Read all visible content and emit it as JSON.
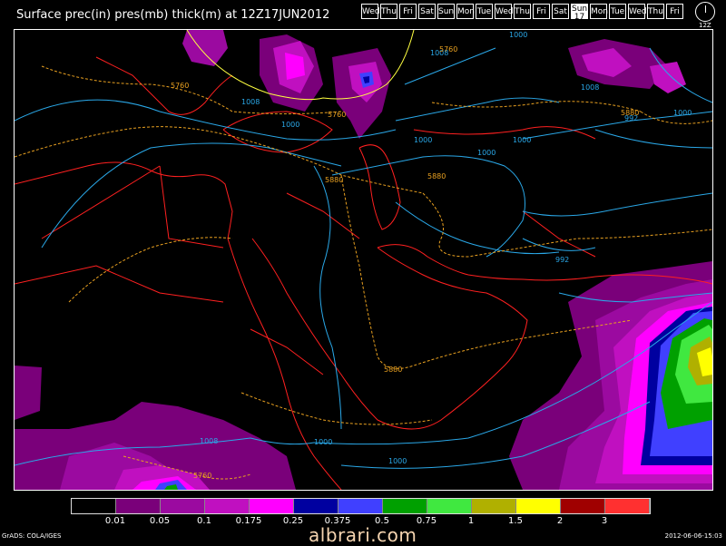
{
  "title": "Surface prec(in) pres(mb) thick(m) at 12Z17JUN2012",
  "day_buttons": [
    "Wed",
    "Thu",
    "Fri",
    "Sat",
    "Sun",
    "Mon",
    "Tue",
    "Wed",
    "Thu",
    "Fri",
    "Sat",
    "Sun",
    "Mon",
    "Tue",
    "Wed",
    "Thu",
    "Fri"
  ],
  "active_day_index": 11,
  "active_day_sub": "17",
  "clock_label": "12Z",
  "colors": {
    "coast": "#ff2020",
    "isobar": "#2aa8e8",
    "thickness_cold": "#ffff40",
    "thickness_warm": "#e8a020"
  },
  "contour_labels": {
    "isobar_1008_a": "1008",
    "isobar_1000_a": "1000",
    "isobar_1000_b": "1000",
    "isobar_1000_c": "1000",
    "isobar_1000_d": "1000",
    "isobar_1000_e": "1000",
    "isobar_1008_b": "1008",
    "isobar_992_a": "992",
    "isobar_992_b": "992",
    "isobar_1008_c": "1008",
    "isobar_1000_top": "1000",
    "isobar_1000_f": "1000",
    "isobar_1000_g": "1000",
    "isobar_1008_d": "1008",
    "thick_5760_a": "5760",
    "thick_5760_b": "5760",
    "thick_5760_c": "5760",
    "thick_5760_d": "5760",
    "thick_5880_a": "5880",
    "thick_5880_b": "5880",
    "thick_5880_c": "5880",
    "thick_5880_d": "5880"
  },
  "legend": {
    "colors": [
      "#000000",
      "#7a007a",
      "#9b0aa0",
      "#c010c0",
      "#ff00ff",
      "#0000a0",
      "#4040ff",
      "#00a000",
      "#40e840",
      "#b0b000",
      "#ffff00",
      "#a00000",
      "#ff3030"
    ],
    "labels": [
      "0.01",
      "0.05",
      "0.1",
      "0.175",
      "0.25",
      "0.375",
      "0.5",
      "0.75",
      "1",
      "1.5",
      "2",
      "3"
    ]
  },
  "footer_left": "GrADS: COLA/IGES",
  "footer_right": "2012-06-06-15:03",
  "watermark": "albrari.com"
}
